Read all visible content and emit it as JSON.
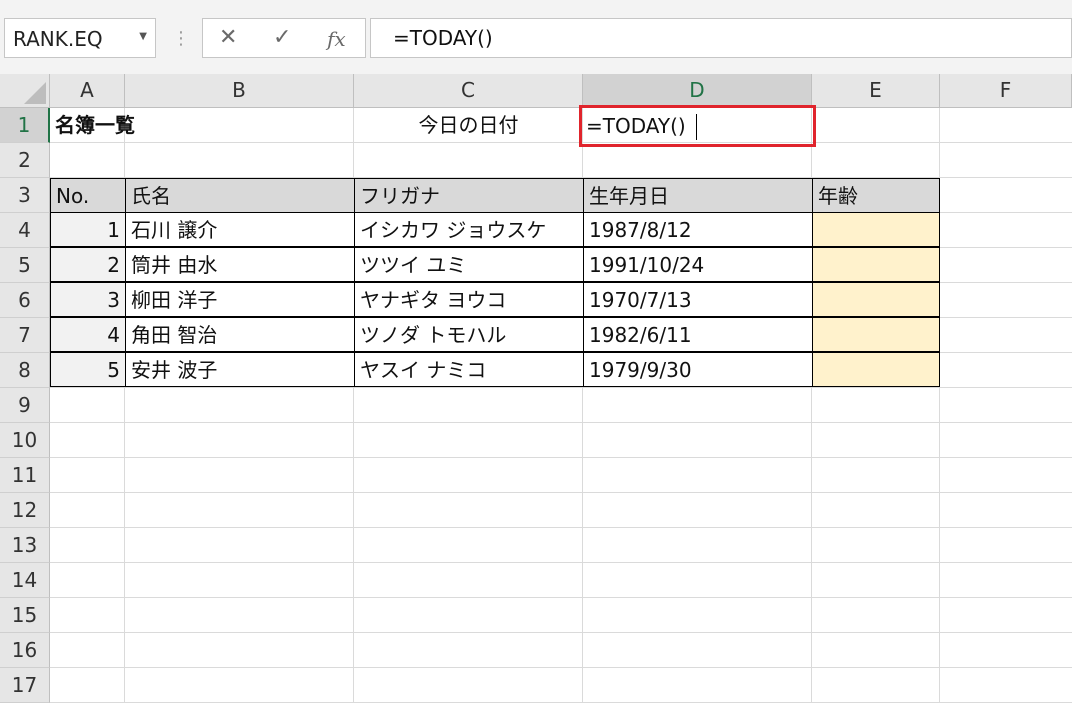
{
  "formula_bar": {
    "name_box": "RANK.EQ",
    "separator": "⋮",
    "cancel_icon": "✕",
    "enter_icon": "✓",
    "fx_label": "fx",
    "formula": "=TODAY()"
  },
  "columns": [
    "A",
    "B",
    "C",
    "D",
    "E",
    "F"
  ],
  "rows": [
    "1",
    "2",
    "3",
    "4",
    "5",
    "6",
    "7",
    "8",
    "9",
    "10",
    "11",
    "12",
    "13",
    "14",
    "15",
    "16",
    "17"
  ],
  "active": {
    "column": "D",
    "row": "1"
  },
  "sheet": {
    "title": "名簿一覧",
    "date_label": "今日の日付",
    "edit_value": "=TODAY()",
    "headers": {
      "no": "No.",
      "name": "氏名",
      "kana": "フリガナ",
      "birth": "生年月日",
      "age": "年齢"
    },
    "records": [
      {
        "no": "1",
        "name": "石川 譲介",
        "kana": "イシカワ ジョウスケ",
        "birth": "1987/8/12",
        "age": ""
      },
      {
        "no": "2",
        "name": "筒井 由水",
        "kana": "ツツイ ユミ",
        "birth": "1991/10/24",
        "age": ""
      },
      {
        "no": "3",
        "name": "柳田 洋子",
        "kana": "ヤナギタ ヨウコ",
        "birth": "1970/7/13",
        "age": ""
      },
      {
        "no": "4",
        "name": "角田 智治",
        "kana": "ツノダ トモハル",
        "birth": "1982/6/11",
        "age": ""
      },
      {
        "no": "5",
        "name": "安井 波子",
        "kana": "ヤスイ ナミコ",
        "birth": "1979/9/30",
        "age": ""
      }
    ]
  },
  "colors": {
    "age_fill": "#fff2cc",
    "header_fill": "#d9d9d9",
    "edit_border": "#e0242c",
    "active_header": "#217346"
  }
}
